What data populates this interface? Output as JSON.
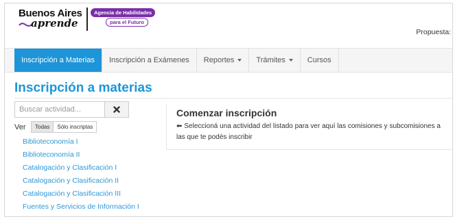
{
  "header": {
    "logo_line1": "Buenos Aires",
    "logo_line2": "aprende",
    "agency_line1": "Agencia de Habilidades",
    "agency_line2": "para el Futuro",
    "propuesta_label": "Propuesta: I"
  },
  "nav": {
    "items": [
      {
        "label": "Inscripción a Materias"
      },
      {
        "label": "Inscripción a Exámenes"
      },
      {
        "label": "Reportes"
      },
      {
        "label": "Trámites"
      },
      {
        "label": "Cursos"
      }
    ]
  },
  "page": {
    "title": "Inscripción a materias"
  },
  "search": {
    "placeholder": "Buscar actividad...",
    "value": ""
  },
  "filter": {
    "label": "Ver",
    "options": [
      "Todas",
      "Sólo inscriptas"
    ],
    "selected": "Todas"
  },
  "activities": [
    "Biblioteconomía I",
    "Biblioteconomía II",
    "Catalogación y Clasificación I",
    "Catalogación y Clasificación II",
    "Catalogación y Clasificación III",
    "Fuentes y Servicios de Información I"
  ],
  "panel": {
    "heading": "Comenzar inscripción",
    "description": "Seleccioná una actividad del listado para ver aquí las comisiones y subcomisiones a las que te podés inscribir"
  },
  "colors": {
    "accent": "#1d95d8",
    "brand_purple": "#7a2ea8",
    "link": "#2d96d7"
  },
  "icons": {
    "clear": "close-icon",
    "dropdown": "chevron-down-icon",
    "arrow": "arrow-left-icon"
  }
}
